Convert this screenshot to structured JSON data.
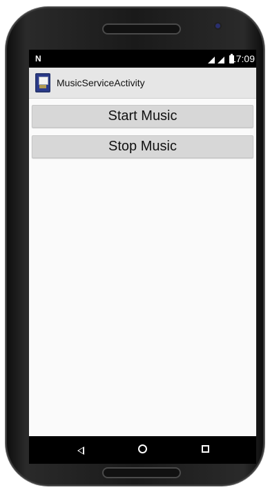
{
  "status_bar": {
    "notification_glyph": "N",
    "time": "17:09",
    "icons": [
      "signal-icon",
      "signal-icon",
      "battery-icon"
    ]
  },
  "app_bar": {
    "title": "MusicServiceActivity",
    "icon": "app-icon"
  },
  "buttons": {
    "start": "Start Music",
    "stop": "Stop Music"
  },
  "navigation": {
    "back_icon": "back-icon",
    "home_icon": "home-icon",
    "recents_icon": "recents-icon"
  },
  "colors": {
    "status_bar_bg": "#000000",
    "app_bar_bg": "#E6E6E6",
    "screen_bg": "#FAFAFA",
    "button_bg": "#D7D7D7",
    "nav_bar_bg": "#000000",
    "phone_frame": "#1A1A1A"
  }
}
